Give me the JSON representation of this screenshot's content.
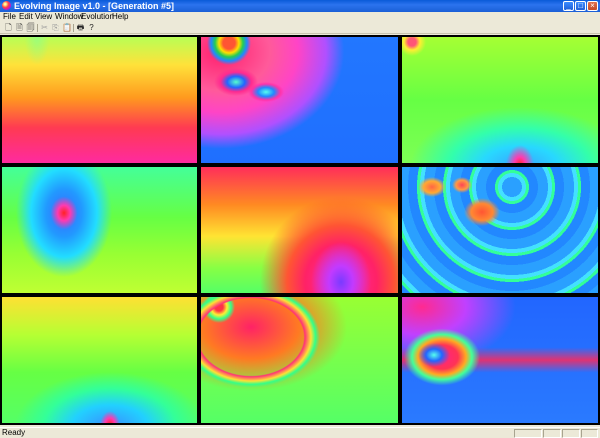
{
  "window": {
    "title": "Evolving Image v1.0 - [Generation #5]",
    "controls": {
      "minimize": "_",
      "maximize": "□",
      "close": "×"
    }
  },
  "menu": [
    "File",
    "Edit",
    "View",
    "Window",
    "Evolution",
    "Help"
  ],
  "toolbar": {
    "buttons": [
      {
        "icon": "new-file-icon",
        "glyph": "🗋",
        "enabled": true
      },
      {
        "icon": "open-file-icon",
        "glyph": "🗎",
        "enabled": true
      },
      {
        "icon": "save-file-icon",
        "glyph": "🗐",
        "enabled": true
      },
      {
        "icon": "cut-icon",
        "glyph": "✂",
        "enabled": false
      },
      {
        "icon": "copy-icon",
        "glyph": "⎘",
        "enabled": false
      },
      {
        "icon": "paste-icon",
        "glyph": "📋",
        "enabled": false
      },
      {
        "icon": "print-icon",
        "glyph": "🖶",
        "enabled": true
      },
      {
        "icon": "help-icon",
        "glyph": "?",
        "enabled": true
      }
    ]
  },
  "tiles": [
    {
      "name": "image-tile-1",
      "style": "warm-gradient"
    },
    {
      "name": "image-tile-2",
      "style": "blue-swirl"
    },
    {
      "name": "image-tile-3",
      "style": "green-glow"
    },
    {
      "name": "image-tile-4",
      "style": "blue-star"
    },
    {
      "name": "image-tile-5",
      "style": "rainbow-rings"
    },
    {
      "name": "image-tile-6",
      "style": "fractal-shards"
    },
    {
      "name": "image-tile-7",
      "style": "green-fan"
    },
    {
      "name": "image-tile-8",
      "style": "green-arc"
    },
    {
      "name": "image-tile-9",
      "style": "blue-vortex"
    }
  ],
  "statusbar": {
    "text": "Ready"
  },
  "colors": {
    "titlebar": "#0a5ad8",
    "chrome": "#ece9d8"
  }
}
